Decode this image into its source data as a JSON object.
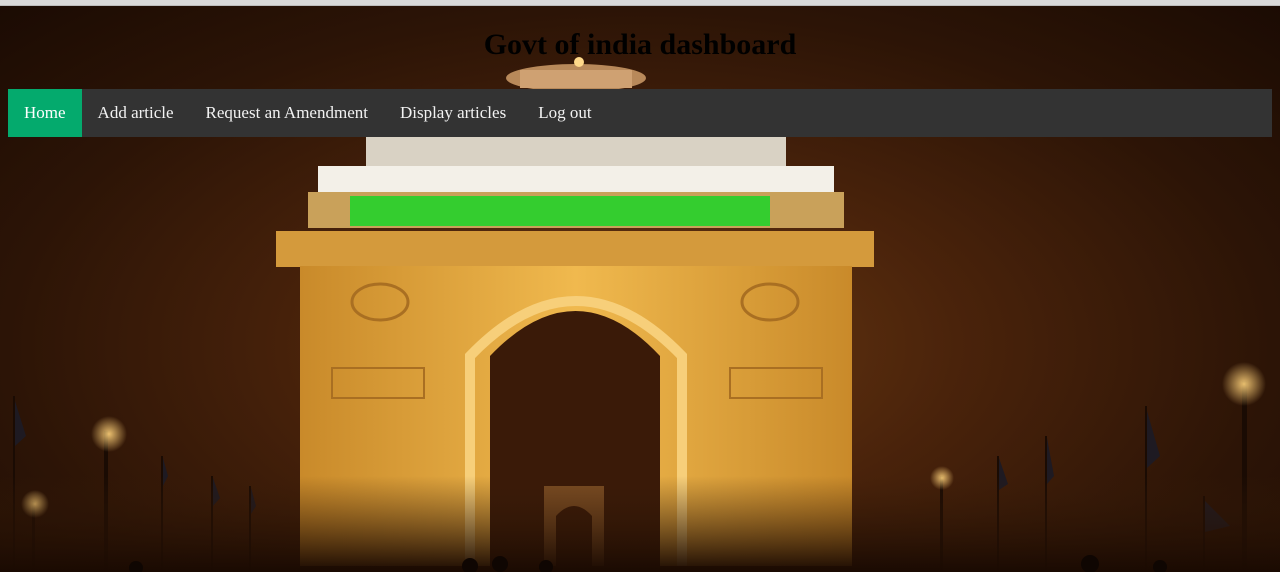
{
  "page": {
    "title": "Govt of india dashboard",
    "background_image": "india-gate-night"
  },
  "nav": {
    "items": [
      {
        "label": "Home",
        "active": true
      },
      {
        "label": "Add article",
        "active": false
      },
      {
        "label": "Request an Amendment",
        "active": false
      },
      {
        "label": "Display articles",
        "active": false
      },
      {
        "label": "Log out",
        "active": false
      }
    ]
  },
  "colors": {
    "nav_bg": "#333333",
    "nav_active": "#04AA6D",
    "nav_text": "#f2f2f2"
  }
}
